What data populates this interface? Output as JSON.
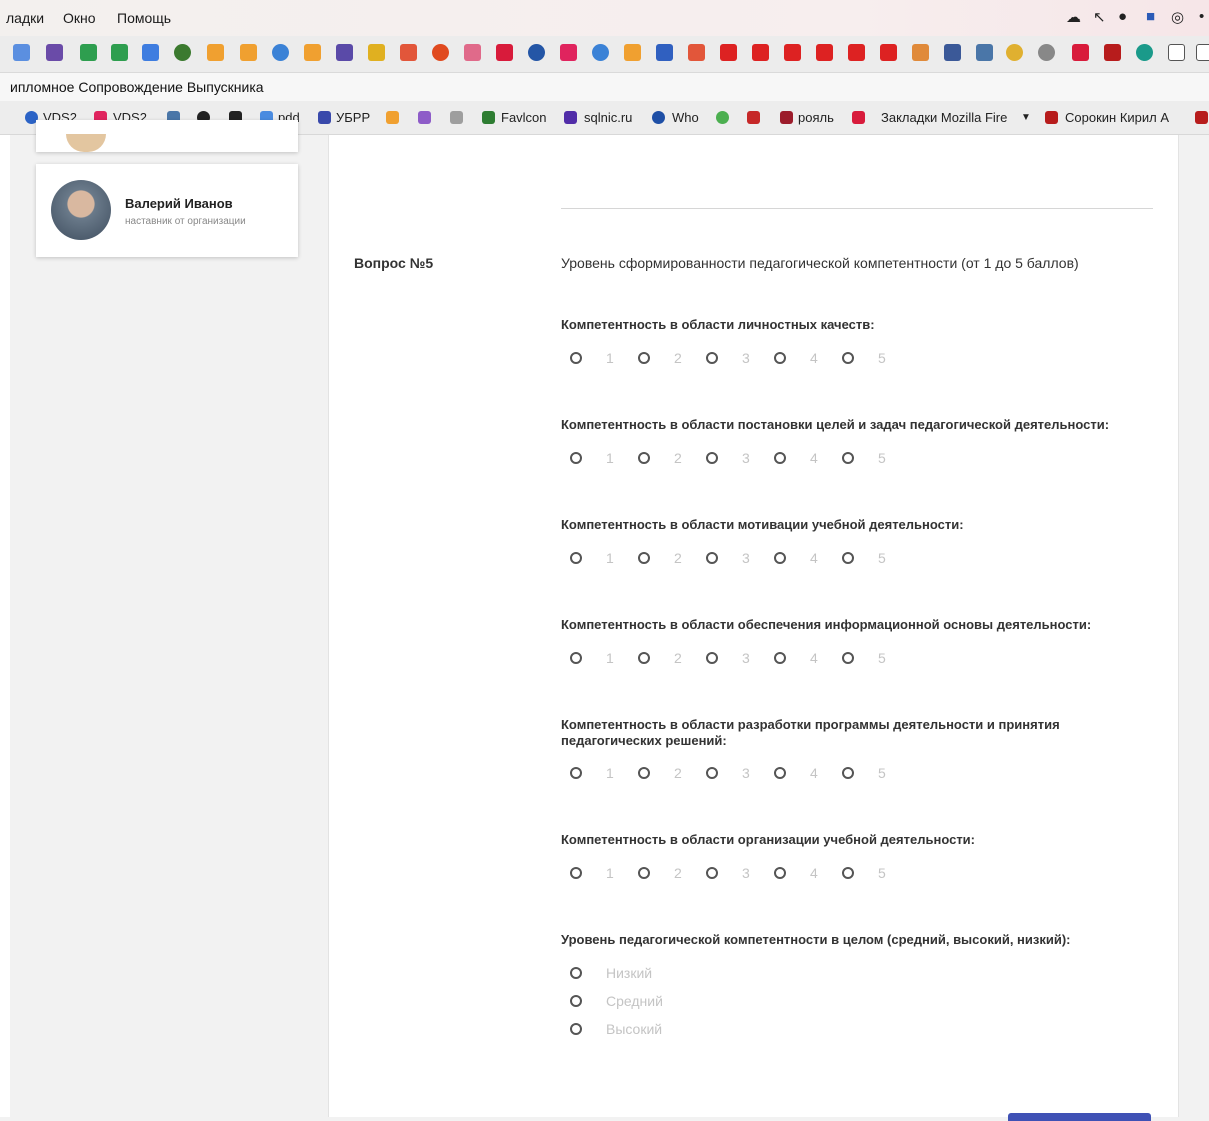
{
  "menubar": {
    "items": [
      "ладки",
      "Окно",
      "Помощь"
    ]
  },
  "page_title": "ипломное Сопровождение Выпускника",
  "bookmarks": [
    {
      "label": "VDS2",
      "color": "#2b63c6"
    },
    {
      "label": "VDS2",
      "color": "#e0245e"
    },
    {
      "label": "pdd",
      "color": "#4a8be0"
    },
    {
      "label": "УБРР",
      "color": "#3949ab"
    },
    {
      "label": "Favlcon",
      "color": "#2e7d32"
    },
    {
      "label": "sqlnic.ru",
      "color": "#512da8"
    },
    {
      "label": "Who",
      "color": "#1e4fa6"
    },
    {
      "label": "рояль",
      "color": "#9c1c2b"
    },
    {
      "label": "Закладки Mozilla Fire",
      "color": "#d81b3b"
    },
    {
      "label": "Сорокин Кирил А",
      "color": "#b71c1c"
    }
  ],
  "profile": {
    "name": "Валерий Иванов",
    "role": "наставник от организации"
  },
  "question": {
    "label": "Вопрос №5",
    "text": "Уровень сформированности педагогической компетентности (от 1 до 5 баллов)"
  },
  "rating_labels": [
    "1",
    "2",
    "3",
    "4",
    "5"
  ],
  "competencies": [
    {
      "title": "Компетентность в области личностных качеств:"
    },
    {
      "title": "Компетентность в области постановки целей и задач педагогической деятельности:"
    },
    {
      "title": "Компетентность в области мотивации учебной деятельности:"
    },
    {
      "title": "Компетентность в области обеспечения информационной основы деятельности:"
    },
    {
      "title": "Компетентность в области разработки программы деятельности и принятия педагогических решений:"
    },
    {
      "title": "Компетентность в области организации учебной деятельности:"
    }
  ],
  "overall": {
    "title": "Уровень педагогической компетентности в целом (средний, высокий, низкий):",
    "options": [
      "Низкий",
      "Средний",
      "Высокий"
    ]
  },
  "colors": {
    "accent": "#3f51b5",
    "radio_border": "#555555",
    "option_label": "#c4c4c4"
  }
}
